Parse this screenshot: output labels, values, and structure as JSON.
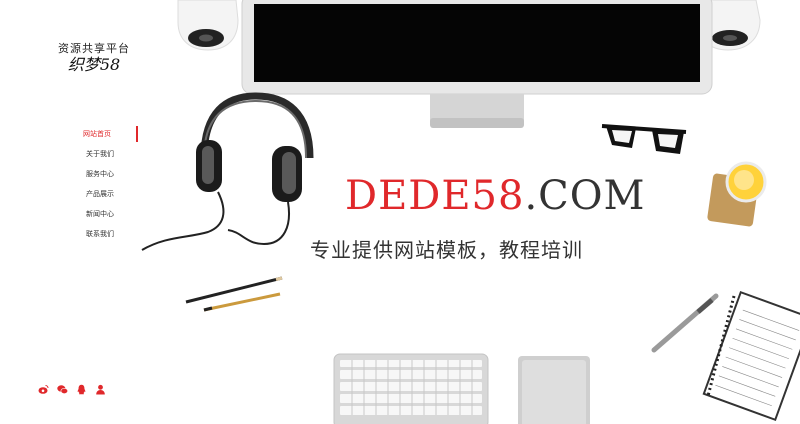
{
  "logo": {
    "subtitle": "资源共享平台",
    "title": "织梦58"
  },
  "nav": {
    "items": [
      {
        "label": "网站首页",
        "active": true
      },
      {
        "label": "关于我们",
        "active": false
      },
      {
        "label": "服务中心",
        "active": false
      },
      {
        "label": "产品展示",
        "active": false
      },
      {
        "label": "新闻中心",
        "active": false
      },
      {
        "label": "联系我们",
        "active": false
      }
    ]
  },
  "social": {
    "icons": [
      "weibo-icon",
      "wechat-icon",
      "qq-icon",
      "person-icon"
    ],
    "color": "#e0282b"
  },
  "hero": {
    "brand": "DEDE58",
    "domain": ".COM",
    "tagline": "专业提供网站模板，教程培训"
  },
  "colors": {
    "accent": "#e0282b",
    "text": "#333333"
  }
}
